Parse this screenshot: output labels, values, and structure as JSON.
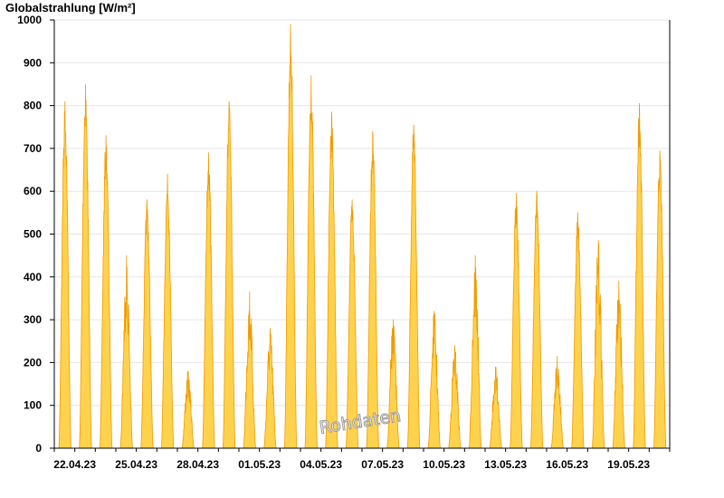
{
  "chart_data": {
    "type": "area",
    "ylabel": "Globalstrahlung [W/m²]",
    "ylim": [
      0,
      1000
    ],
    "y_ticks": [
      0,
      100,
      200,
      300,
      400,
      500,
      600,
      700,
      800,
      900,
      1000
    ],
    "x_range": [
      "2023-04-21",
      "2023-05-21"
    ],
    "x_tick_labels": [
      "22.04.23",
      "25.04.23",
      "28.04.23",
      "01.05.23",
      "04.05.23",
      "07.05.23",
      "10.05.23",
      "13.05.23",
      "16.05.23",
      "19.05.23"
    ],
    "grid": true,
    "fill_color": "#ffd24d",
    "line_color": "#f09a00",
    "watermark": "Rohdaten",
    "series": [
      {
        "x_unit": "day",
        "daily_peaks": [
          {
            "date": "2023-04-21",
            "peak": 810
          },
          {
            "date": "2023-04-22",
            "peak": 850
          },
          {
            "date": "2023-04-23",
            "peak": 730
          },
          {
            "date": "2023-04-24",
            "peak": 450
          },
          {
            "date": "2023-04-25",
            "peak": 580
          },
          {
            "date": "2023-04-26",
            "peak": 640
          },
          {
            "date": "2023-04-27",
            "peak": 180
          },
          {
            "date": "2023-04-28",
            "peak": 690
          },
          {
            "date": "2023-04-29",
            "peak": 810
          },
          {
            "date": "2023-04-30",
            "peak": 365
          },
          {
            "date": "2023-05-01",
            "peak": 280
          },
          {
            "date": "2023-05-02",
            "peak": 990
          },
          {
            "date": "2023-05-03",
            "peak": 870
          },
          {
            "date": "2023-05-04",
            "peak": 785
          },
          {
            "date": "2023-05-05",
            "peak": 580
          },
          {
            "date": "2023-05-06",
            "peak": 740
          },
          {
            "date": "2023-05-07",
            "peak": 300
          },
          {
            "date": "2023-05-08",
            "peak": 755
          },
          {
            "date": "2023-05-09",
            "peak": 320
          },
          {
            "date": "2023-05-10",
            "peak": 240
          },
          {
            "date": "2023-05-11",
            "peak": 450
          },
          {
            "date": "2023-05-12",
            "peak": 190
          },
          {
            "date": "2023-05-13",
            "peak": 595
          },
          {
            "date": "2023-05-14",
            "peak": 600
          },
          {
            "date": "2023-05-15",
            "peak": 215
          },
          {
            "date": "2023-05-16",
            "peak": 550
          },
          {
            "date": "2023-05-17",
            "peak": 485
          },
          {
            "date": "2023-05-18",
            "peak": 390
          },
          {
            "date": "2023-05-19",
            "peak": 805
          },
          {
            "date": "2023-05-20",
            "peak": 695
          }
        ]
      }
    ]
  }
}
